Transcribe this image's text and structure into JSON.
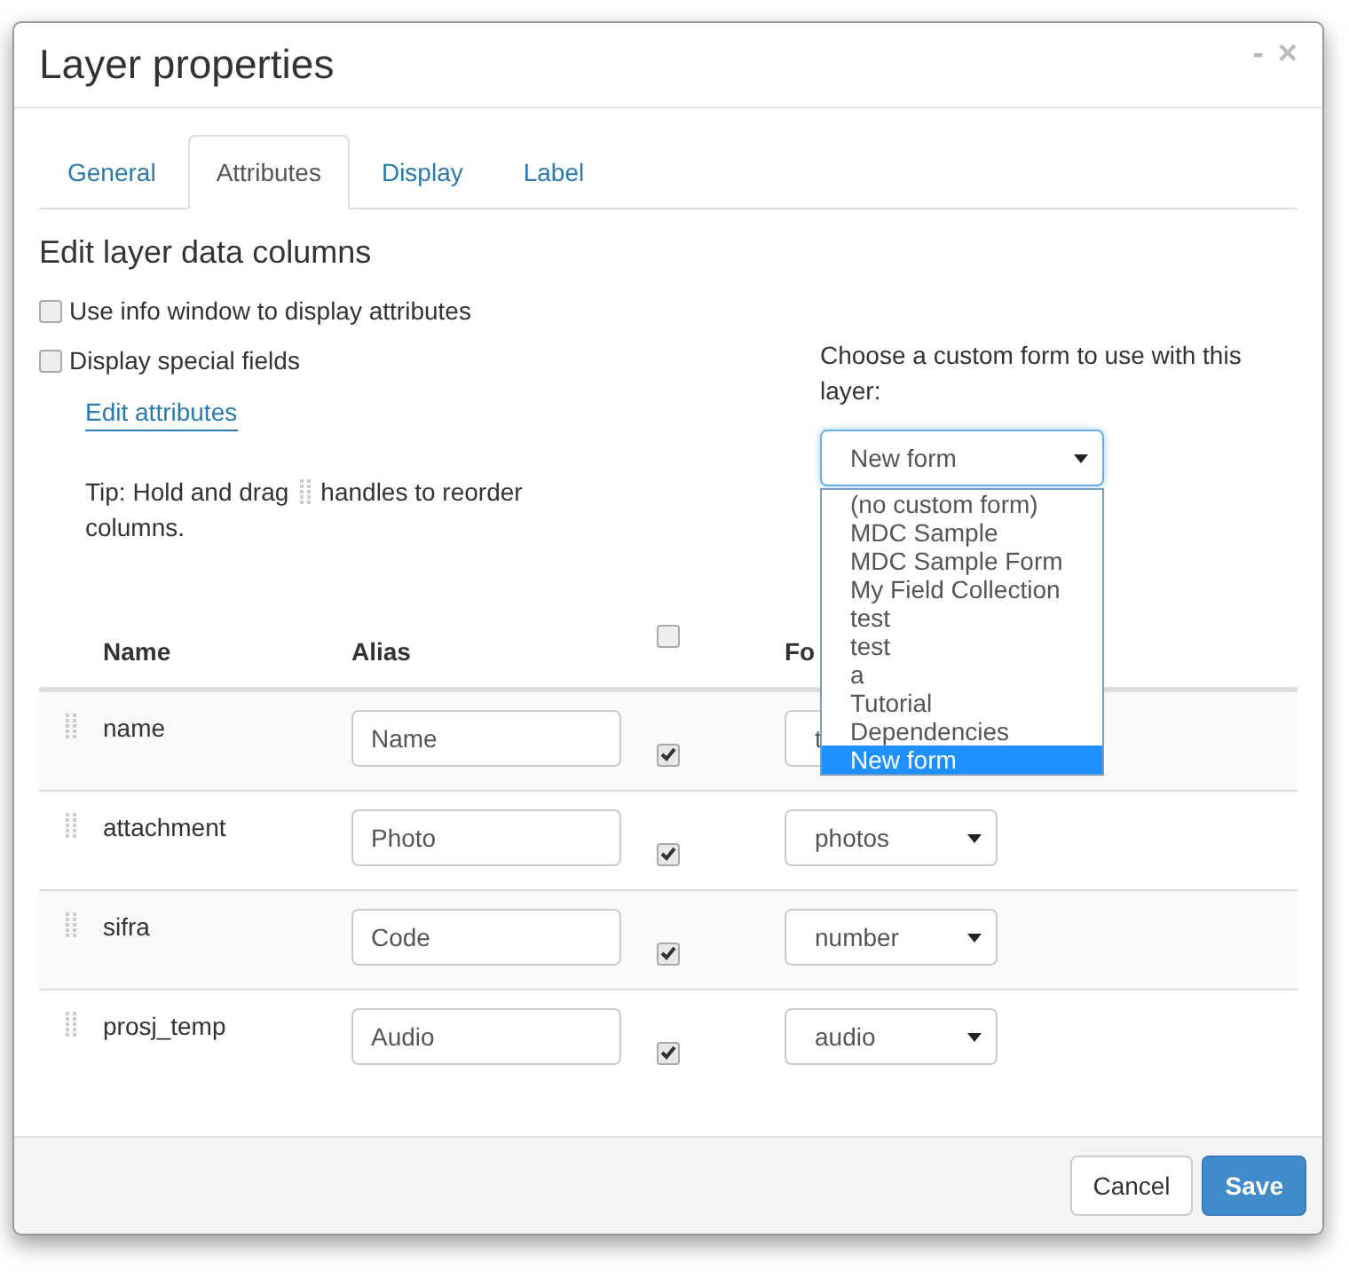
{
  "window": {
    "title": "Layer properties",
    "minimize": "-",
    "close": "×"
  },
  "tabs": [
    {
      "label": "General",
      "selected": false
    },
    {
      "label": "Attributes",
      "selected": true
    },
    {
      "label": "Display",
      "selected": false
    },
    {
      "label": "Label",
      "selected": false
    }
  ],
  "section_title": "Edit layer data columns",
  "options": [
    {
      "label": "Use info window to display attributes",
      "checked": false
    },
    {
      "label": "Display special fields",
      "checked": false
    }
  ],
  "edit_link": "Edit attributes",
  "tip": {
    "before": "Tip: Hold and drag",
    "after": "handles to reorder",
    "end": "columns."
  },
  "custom_form": {
    "label": "Choose a custom form to use with this layer:",
    "value": "New form",
    "open": true,
    "options": [
      {
        "label": "(no custom form)",
        "selected": false
      },
      {
        "label": "MDC Sample",
        "selected": false
      },
      {
        "label": "MDC Sample Form",
        "selected": false
      },
      {
        "label": "My Field Collection",
        "selected": false
      },
      {
        "label": "test",
        "selected": false
      },
      {
        "label": "test",
        "selected": false
      },
      {
        "label": "a",
        "selected": false
      },
      {
        "label": "Tutorial",
        "selected": false
      },
      {
        "label": "Dependencies",
        "selected": false
      },
      {
        "label": "New form",
        "selected": true
      }
    ]
  },
  "table": {
    "columns": [
      "Name",
      "Alias",
      "Fo"
    ],
    "select_all_checked": false,
    "rows": [
      {
        "name": "name",
        "alias": "Name",
        "visible": true,
        "format": "t",
        "covered": true
      },
      {
        "name": "attachment",
        "alias": "Photo",
        "visible": true,
        "format": "photos",
        "covered": false
      },
      {
        "name": "sifra",
        "alias": "Code",
        "visible": true,
        "format": "number",
        "covered": false
      },
      {
        "name": "prosj_temp",
        "alias": "Audio",
        "visible": true,
        "format": "audio",
        "covered": false
      }
    ]
  },
  "buttons": [
    {
      "label": "Cancel",
      "kind": "default"
    },
    {
      "label": "Save",
      "kind": "primary"
    }
  ]
}
